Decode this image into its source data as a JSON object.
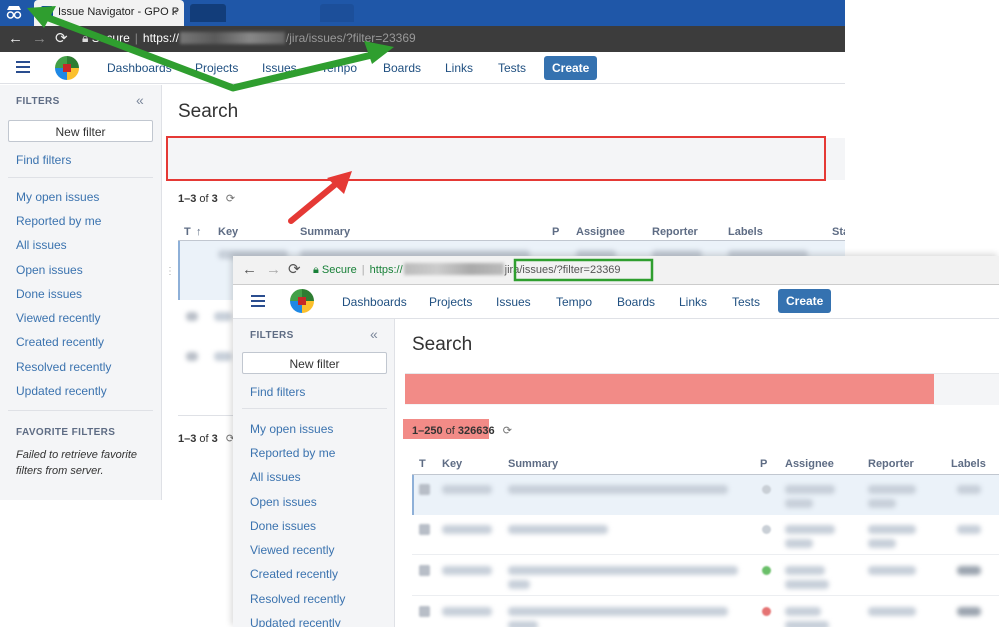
{
  "colors": {
    "annotation_green": "#2f9e2f",
    "annotation_red": "#e53935",
    "jira_blue": "#3572b0",
    "link_blue": "#3b73af",
    "highlight_red": "#f28b87"
  },
  "window_back": {
    "tab_title": "Issue Navigator - GPO P",
    "tab_close_icon": "×",
    "address": {
      "secure_label": "Secure",
      "scheme": "https://",
      "path": "/jira/issues/?filter=23369"
    },
    "nav": {
      "links": [
        "Dashboards",
        "Projects",
        "Issues",
        "Tempo",
        "Boards",
        "Links",
        "Tests"
      ],
      "create_label": "Create"
    },
    "sidebar": {
      "filters_heading": "FILTERS",
      "collapse_icon": "«",
      "new_filter_label": "New filter",
      "find_filters_label": "Find filters",
      "items": [
        "My open issues",
        "Reported by me",
        "All issues",
        "Open issues",
        "Done issues",
        "Viewed recently",
        "Created recently",
        "Resolved recently",
        "Updated recently"
      ],
      "favorite_heading": "FAVORITE FILTERS",
      "favorite_note": "Failed to retrieve favorite filters from server."
    },
    "main": {
      "title": "Search",
      "count_prefix": "1–3",
      "count_of": "of",
      "count_total": "3",
      "refresh_icon": "⟳",
      "columns": [
        "T",
        "Key",
        "Summary",
        "P",
        "Assignee",
        "Reporter",
        "Labels",
        "Sta"
      ],
      "sort_icon": "↑"
    }
  },
  "window_front": {
    "address": {
      "secure_label": "Secure",
      "scheme": "https://",
      "path": "jira/issues/?filter=23369"
    },
    "nav": {
      "links": [
        "Dashboards",
        "Projects",
        "Issues",
        "Tempo",
        "Boards",
        "Links",
        "Tests"
      ],
      "create_label": "Create"
    },
    "sidebar": {
      "filters_heading": "FILTERS",
      "collapse_icon": "«",
      "new_filter_label": "New filter",
      "find_filters_label": "Find filters",
      "items": [
        "My open issues",
        "Reported by me",
        "All issues",
        "Open issues",
        "Done issues",
        "Viewed recently",
        "Created recently",
        "Resolved recently",
        "Updated recently"
      ]
    },
    "main": {
      "title": "Search",
      "count_prefix": "1–250",
      "count_of": "of",
      "count_total": "326636",
      "refresh_icon": "⟳",
      "columns": [
        "T",
        "Key",
        "Summary",
        "P",
        "Assignee",
        "Reporter",
        "Labels"
      ]
    }
  }
}
